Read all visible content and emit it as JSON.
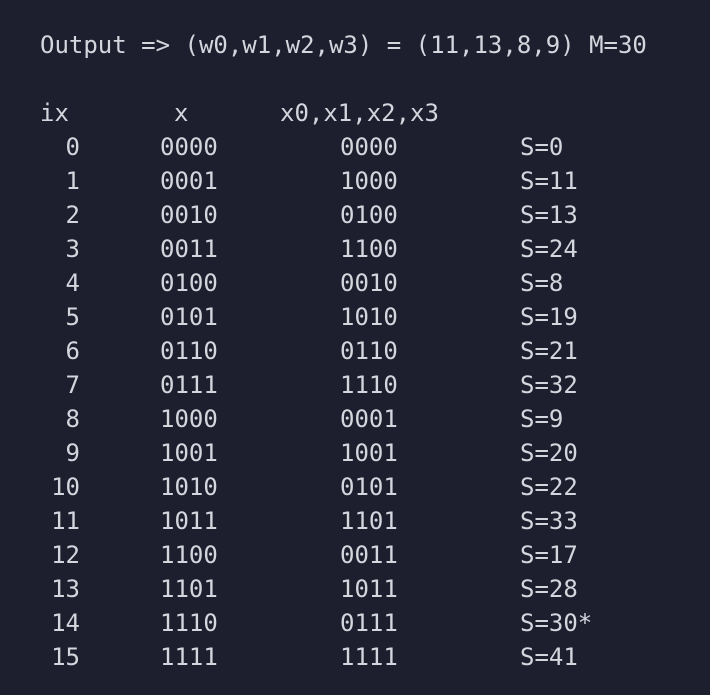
{
  "output_line": "Output => (w0,w1,w2,w3) = (11,13,8,9) M=30",
  "headers": {
    "ix": "ix",
    "x": "x",
    "xs": "x0,x1,x2,x3"
  },
  "rows": [
    {
      "ix": "0",
      "x": "0000",
      "xs": "0000",
      "s": "S=0"
    },
    {
      "ix": "1",
      "x": "0001",
      "xs": "1000",
      "s": "S=11"
    },
    {
      "ix": "2",
      "x": "0010",
      "xs": "0100",
      "s": "S=13"
    },
    {
      "ix": "3",
      "x": "0011",
      "xs": "1100",
      "s": "S=24"
    },
    {
      "ix": "4",
      "x": "0100",
      "xs": "0010",
      "s": "S=8"
    },
    {
      "ix": "5",
      "x": "0101",
      "xs": "1010",
      "s": "S=19"
    },
    {
      "ix": "6",
      "x": "0110",
      "xs": "0110",
      "s": "S=21"
    },
    {
      "ix": "7",
      "x": "0111",
      "xs": "1110",
      "s": "S=32"
    },
    {
      "ix": "8",
      "x": "1000",
      "xs": "0001",
      "s": "S=9"
    },
    {
      "ix": "9",
      "x": "1001",
      "xs": "1001",
      "s": "S=20"
    },
    {
      "ix": "10",
      "x": "1010",
      "xs": "0101",
      "s": "S=22"
    },
    {
      "ix": "11",
      "x": "1011",
      "xs": "1101",
      "s": "S=33"
    },
    {
      "ix": "12",
      "x": "1100",
      "xs": "0011",
      "s": "S=17"
    },
    {
      "ix": "13",
      "x": "1101",
      "xs": "1011",
      "s": "S=28"
    },
    {
      "ix": "14",
      "x": "1110",
      "xs": "0111",
      "s": "S=30*"
    },
    {
      "ix": "15",
      "x": "1111",
      "xs": "1111",
      "s": "S=41"
    }
  ]
}
